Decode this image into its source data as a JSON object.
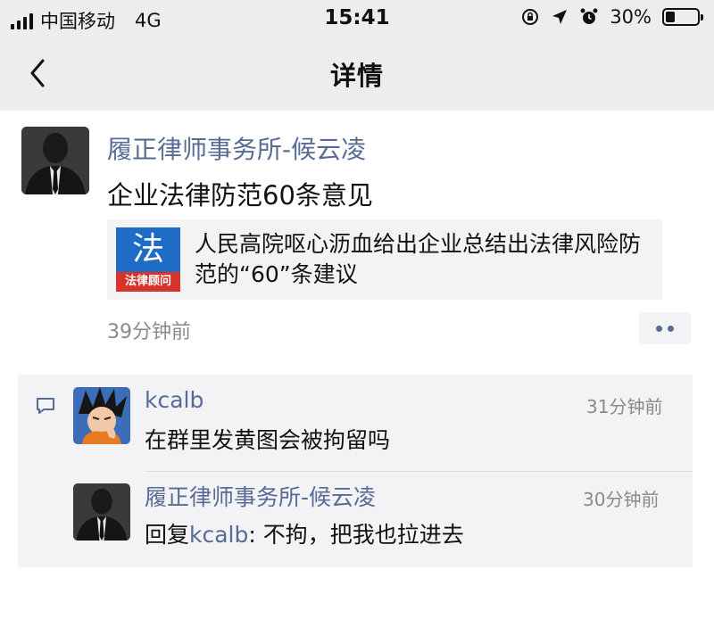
{
  "status_bar": {
    "carrier": "中国移动",
    "network": "4G",
    "time": "15:41",
    "battery_percent": "30%",
    "battery_level": 0.3
  },
  "nav": {
    "back_icon": "chevron-left-icon",
    "title": "详情"
  },
  "post": {
    "author": "履正律师事务所-候云凌",
    "text": "企业法律防范60条意见",
    "link": {
      "thumb_char": "法",
      "thumb_label": "法律顾问",
      "title": "人民高院呕心沥血给出企业总结出法律风险防范的“60”条建议"
    },
    "time": "39分钟前",
    "more_icon": "more-dots-icon"
  },
  "comments": [
    {
      "author": "kcalb",
      "time": "31分钟前",
      "text": "在群里发黄图会被拘留吗"
    },
    {
      "author": "履正律师事务所-候云凌",
      "time": "30分钟前",
      "reply_prefix": "回复",
      "reply_to": "kcalb",
      "reply_sep": ": ",
      "text": "不拘，把我也拉进去"
    }
  ],
  "colors": {
    "link_blue": "#576b95",
    "header_bg": "#ededed",
    "card_bg": "#f3f3f5"
  }
}
